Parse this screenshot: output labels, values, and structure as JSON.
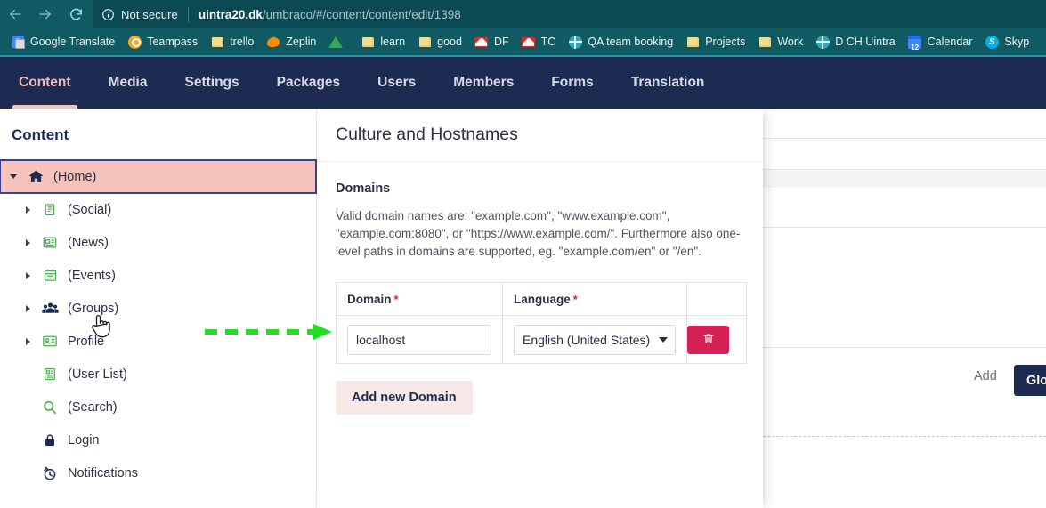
{
  "browser": {
    "back_icon": "arrow-left-icon",
    "forward_icon": "arrow-right-icon",
    "reload_icon": "reload-icon",
    "security_icon": "info-circle-icon",
    "security_label": "Not secure",
    "url_host": "uintra20.dk",
    "url_path": "/umbraco/#/content/content/edit/1398",
    "bookmarks": [
      {
        "label": "Google Translate",
        "icon": "google-translate-icon"
      },
      {
        "label": "Teampass",
        "icon": "teampass-icon"
      },
      {
        "label": "trello",
        "icon": "folder-icon"
      },
      {
        "label": "Zeplin",
        "icon": "zeplin-icon"
      },
      {
        "label": "",
        "icon": "google-drive-icon"
      },
      {
        "label": "learn",
        "icon": "folder-icon"
      },
      {
        "label": "good",
        "icon": "folder-icon"
      },
      {
        "label": "DF",
        "icon": "gmail-icon"
      },
      {
        "label": "TC",
        "icon": "gmail-icon"
      },
      {
        "label": "QA team booking",
        "icon": "globe-icon"
      },
      {
        "label": "Projects",
        "icon": "folder-icon"
      },
      {
        "label": "Work",
        "icon": "folder-icon"
      },
      {
        "label": "D CH Uintra",
        "icon": "globe-icon"
      },
      {
        "label": "Calendar",
        "icon": "calendar-icon"
      },
      {
        "label": "Skyp",
        "icon": "skype-icon"
      }
    ]
  },
  "top_nav": {
    "active": "Content",
    "items": [
      {
        "label": "Content"
      },
      {
        "label": "Media"
      },
      {
        "label": "Settings"
      },
      {
        "label": "Packages"
      },
      {
        "label": "Users"
      },
      {
        "label": "Members"
      },
      {
        "label": "Forms"
      },
      {
        "label": "Translation"
      }
    ]
  },
  "tree": {
    "header": "Content",
    "items": [
      {
        "label": "(Home)",
        "icon": "home-icon",
        "level": 1,
        "expandable": true,
        "expanded": true,
        "selected": true,
        "icon_color": "navy"
      },
      {
        "label": "(Social)",
        "icon": "notepad-icon",
        "level": 2,
        "expandable": true,
        "expanded": false,
        "selected": false,
        "icon_color": "green"
      },
      {
        "label": "(News)",
        "icon": "news-icon",
        "level": 2,
        "expandable": true,
        "expanded": false,
        "selected": false,
        "icon_color": "green"
      },
      {
        "label": "(Events)",
        "icon": "calendar-icon",
        "level": 2,
        "expandable": true,
        "expanded": false,
        "selected": false,
        "icon_color": "green"
      },
      {
        "label": "(Groups)",
        "icon": "people-icon",
        "level": 2,
        "expandable": true,
        "expanded": false,
        "selected": false,
        "icon_color": "navy"
      },
      {
        "label": "Profile",
        "icon": "id-card-icon",
        "level": 2,
        "expandable": true,
        "expanded": false,
        "selected": false,
        "icon_color": "green"
      },
      {
        "label": "(User List)",
        "icon": "article-icon",
        "level": 2,
        "expandable": false,
        "expanded": false,
        "selected": false,
        "icon_color": "green"
      },
      {
        "label": "(Search)",
        "icon": "search-icon",
        "level": 2,
        "expandable": false,
        "expanded": false,
        "selected": false,
        "icon_color": "green"
      },
      {
        "label": "Login",
        "icon": "lock-icon",
        "level": 2,
        "expandable": false,
        "expanded": false,
        "selected": false,
        "icon_color": "navy"
      },
      {
        "label": "Notifications",
        "icon": "alarm-clock-icon",
        "level": 2,
        "expandable": false,
        "expanded": false,
        "selected": false,
        "icon_color": "navy"
      }
    ]
  },
  "overlay": {
    "title": "Culture and Hostnames",
    "section_title": "Domains",
    "description": "Valid domain names are: \"example.com\", \"www.example.com\", \"example.com:8080\", or \"https://www.example.com/\". Furthermore also one-level paths in domains are supported, eg. \"example.com/en\" or \"/en\".",
    "table": {
      "headers": {
        "domain": "Domain",
        "language": "Language",
        "required_mark": "*"
      },
      "rows": [
        {
          "domain_value": "localhost",
          "domain_placeholder": "",
          "language_value": "English (United States)",
          "delete_icon": "trash-icon"
        }
      ]
    },
    "add_domain_label": "Add new Domain"
  },
  "under_page": {
    "add_label": "Add",
    "global_label": "Global"
  },
  "annotation": {
    "arrow_icon": "dashed-arrow-right",
    "color": "#22dd22"
  },
  "cursor": {
    "icon": "pointer-hand-cursor"
  },
  "colors": {
    "browser_chrome": "#0f5a63",
    "omnibox": "#0b4a52",
    "umb_nav": "#1d2b53",
    "umb_nav_top_rule": "#2a96a5",
    "accent_pink": "#f2c3bd",
    "selected_row": "#f5c3bb",
    "danger": "#d42054",
    "tree_icon_green": "#4caf50",
    "annotation_green": "#22dd22"
  }
}
